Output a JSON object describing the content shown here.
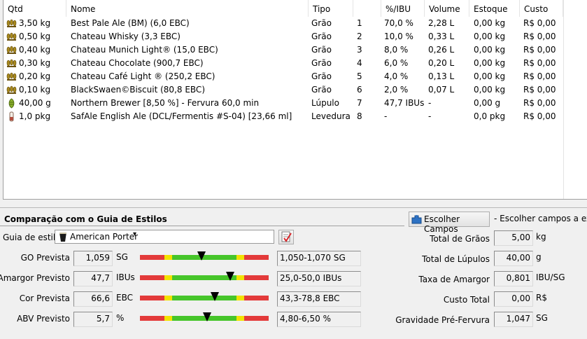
{
  "ingredients": {
    "headers": [
      "Qtd",
      "Nome",
      "Tipo",
      "",
      "%/IBU",
      "Volume",
      "Estoque",
      "Custo"
    ],
    "rows": [
      {
        "icon": "grain-icon",
        "qty": "3,50 kg",
        "name": "Best  Pale Ale  (BM) (6,0 EBC)",
        "type": "Grão",
        "num": "1",
        "pct": "70,0 %",
        "volume": "2,28 L",
        "stock": "0,00 kg",
        "cost": "R$ 0,00"
      },
      {
        "icon": "grain-icon",
        "qty": "0,50 kg",
        "name": "Chateau Whisky (3,3 EBC)",
        "type": "Grão",
        "num": "2",
        "pct": "10,0 %",
        "volume": "0,33 L",
        "stock": "0,00 kg",
        "cost": "R$ 0,00"
      },
      {
        "icon": "grain-icon",
        "qty": "0,40 kg",
        "name": "Chateau Munich Light® (15,0 EBC)",
        "type": "Grão",
        "num": "3",
        "pct": "8,0 %",
        "volume": "0,26 L",
        "stock": "0,00 kg",
        "cost": "R$ 0,00"
      },
      {
        "icon": "grain-icon",
        "qty": "0,30 kg",
        "name": "Chateau Chocolate  (900,7 EBC)",
        "type": "Grão",
        "num": "4",
        "pct": "6,0 %",
        "volume": "0,20 L",
        "stock": "0,00 kg",
        "cost": "R$ 0,00"
      },
      {
        "icon": "grain-icon",
        "qty": "0,20 kg",
        "name": "Chateau Café Light ® (250,2 EBC)",
        "type": "Grão",
        "num": "5",
        "pct": "4,0 %",
        "volume": "0,13 L",
        "stock": "0,00 kg",
        "cost": "R$ 0,00"
      },
      {
        "icon": "grain-icon",
        "qty": "0,10 kg",
        "name": "BlackSwaen©Biscuit (80,8 EBC)",
        "type": "Grão",
        "num": "6",
        "pct": "2,0 %",
        "volume": "0,07 L",
        "stock": "0,00 kg",
        "cost": "R$ 0,00"
      },
      {
        "icon": "hop-icon",
        "qty": "40,00 g",
        "name": "Northern Brewer [8,50 %] - Fervura 60,0 min",
        "type": "Lúpulo",
        "num": "7",
        "pct": "47,7 IBUs",
        "volume": "-",
        "stock": "0,00 g",
        "cost": "R$ 0,00"
      },
      {
        "icon": "yeast-vial-icon",
        "qty": "1,0 pkg",
        "name": "SafAle English Ale (DCL/Fermentis #S-04) [23,66 ml]",
        "type": "Levedura",
        "num": "8",
        "pct": "-",
        "volume": "-",
        "stock": "0,0 pkg",
        "cost": "R$ 0,00"
      }
    ]
  },
  "style_guide": {
    "title": "Comparação com o Guia de Estilos",
    "label": "Guia de estilo",
    "selected": "American Porter",
    "metrics": [
      {
        "label": "GO Prevista",
        "value": "1,059",
        "unit": "SG",
        "range": "1,050-1,070 SG",
        "position": 0.48
      },
      {
        "label": "Amargor Previsto",
        "value": "47,7",
        "unit": "IBUs",
        "range": "25,0-50,0 IBUs",
        "position": 0.7
      },
      {
        "label": "Cor Prevista",
        "value": "66,6",
        "unit": "EBC",
        "range": "43,3-78,8 EBC",
        "position": 0.58
      },
      {
        "label": "ABV Previsto",
        "value": "5,7",
        "unit": "%",
        "range": "4,80-6,50 %",
        "position": 0.52
      }
    ]
  },
  "fields": {
    "button_label": "Escolher Campos",
    "hint": "- Escolher campos a exibi",
    "items": [
      {
        "label": "Total de Grãos",
        "value": "5,00",
        "unit": "kg"
      },
      {
        "label": "Total de Lúpulos",
        "value": "40,00",
        "unit": "g"
      },
      {
        "label": "Taxa de Amargor",
        "value": "0,801",
        "unit": "IBU/SG"
      },
      {
        "label": "Custo Total",
        "value": "0,00",
        "unit": "R$"
      },
      {
        "label": "Gravidade Pré-Fervura",
        "value": "1,047",
        "unit": "SG"
      }
    ]
  },
  "colors": {
    "bar_red": "#e33a3a",
    "bar_yellow": "#f2e200",
    "bar_green": "#46c52a"
  }
}
